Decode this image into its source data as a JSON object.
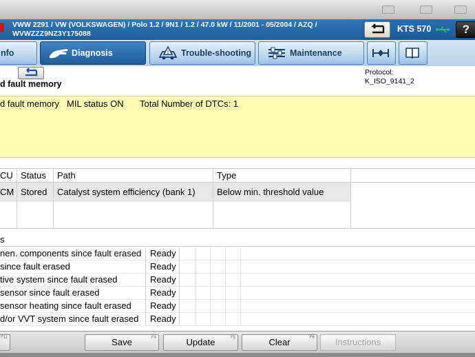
{
  "header": {
    "vehicle_line1": "VWW 2291 / VW (VOLKSWAGEN) / Polo 1.2 / 9N1 / 1.2 / 47.0 kW / 11/2001 - 05/2004 / AZQ /",
    "vehicle_line2": "WVWZZZ9NZ3Y175088",
    "device": "KTS 570",
    "help_label": "?"
  },
  "tabs": [
    {
      "label": "nfo",
      "icon": "info-icon",
      "active": false
    },
    {
      "label": "Diagnosis",
      "icon": "diagnosis-hand-icon",
      "active": true
    },
    {
      "label": "Trouble-shooting",
      "icon": "car-warning-icon",
      "active": false
    },
    {
      "label": "Maintenance",
      "icon": "sliders-icon",
      "active": false
    },
    {
      "label": "",
      "icon": "measure-icon",
      "active": false
    },
    {
      "label": "",
      "icon": "book-icon",
      "active": false
    }
  ],
  "page": {
    "title": "d fault memory",
    "protocol_label": "Protocol:",
    "protocol_value": "K_ISO_9141_2"
  },
  "summary": {
    "memory_label": "d fault memory",
    "mil_status": "MIL status ON",
    "dtc_count": "Total Number of DTCs: 1"
  },
  "dtc_table": {
    "columns": [
      "CU",
      "Status",
      "Path",
      "Type"
    ],
    "rows": [
      {
        "ecu": "CM",
        "status": "Stored",
        "path": "Catalyst system efficiency (bank 1)",
        "type": "Below min. threshold value"
      }
    ]
  },
  "readiness": {
    "title": "s",
    "rows": [
      {
        "name": "nen. components since fault erased",
        "value": "Ready"
      },
      {
        "name": "since fault erased",
        "value": "Ready"
      },
      {
        "name": "tive system since fault erased",
        "value": "Ready"
      },
      {
        "name": "sensor since fault erased",
        "value": "Ready"
      },
      {
        "name": "sensor heating since fault erased",
        "value": "Ready"
      },
      {
        "name": "d/or VVT system since fault erased",
        "value": "Ready"
      }
    ]
  },
  "buttons": {
    "f11": {
      "label": "",
      "key": "F11"
    },
    "save": {
      "label": "Save",
      "key": "F4"
    },
    "update": {
      "label": "Update",
      "key": "F5"
    },
    "clear": {
      "label": "Clear",
      "key": "F6"
    },
    "instructions": {
      "label": "Instructions",
      "key": ""
    }
  },
  "colors": {
    "header_blue": "#1e5f9b",
    "summary_yellow": "#fdfbb4",
    "brand_red": "#d01010"
  }
}
